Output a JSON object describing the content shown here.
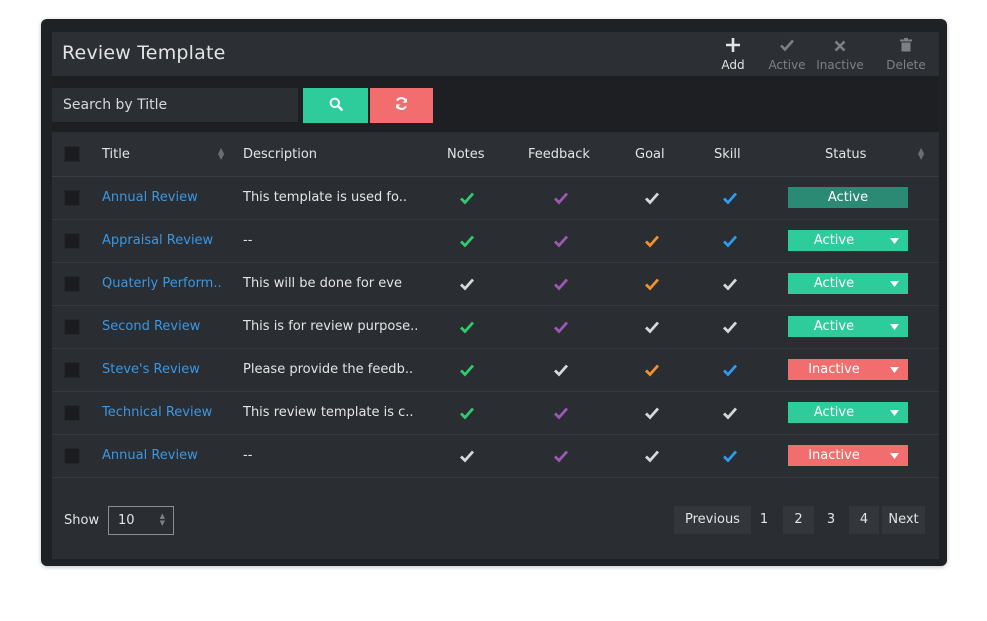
{
  "header": {
    "title": "Review Template",
    "tools": [
      {
        "label": "Add",
        "icon": "plus-icon",
        "enabled": true
      },
      {
        "label": "Active",
        "icon": "check-icon",
        "enabled": false
      },
      {
        "label": "Inactive",
        "icon": "x-icon",
        "enabled": false
      },
      {
        "label": "Delete",
        "icon": "trash-icon",
        "enabled": false
      }
    ]
  },
  "search": {
    "placeholder": "Search by Title",
    "value": ""
  },
  "colors": {
    "accent_green": "#2ecc9b",
    "accent_red": "#f26d6d",
    "link_blue": "#3b97e3",
    "check_green": "#2ecc71",
    "check_purple": "#9b59b6",
    "check_orange": "#f0932b",
    "check_gray": "#d8d9db",
    "check_blue": "#2d9cf0"
  },
  "table": {
    "columns": [
      "Title",
      "Description",
      "Notes",
      "Feedback",
      "Goal",
      "Skill",
      "Status"
    ],
    "rows": [
      {
        "title": "Annual Review",
        "description": "This template is used fo..",
        "notes": "green",
        "feedback": "purple",
        "goal": "gray",
        "skill": "blue",
        "status": "Active",
        "status_style": "dark"
      },
      {
        "title": "Appraisal Review",
        "description": "--",
        "notes": "green",
        "feedback": "purple",
        "goal": "orange",
        "skill": "blue",
        "status": "Active",
        "status_style": "green"
      },
      {
        "title": "Quaterly Perform..",
        "description": "This will be done for eve",
        "notes": "gray",
        "feedback": "purple",
        "goal": "orange",
        "skill": "gray",
        "status": "Active",
        "status_style": "green"
      },
      {
        "title": "Second Review",
        "description": "This is for review purpose..",
        "notes": "green",
        "feedback": "purple",
        "goal": "gray",
        "skill": "gray",
        "status": "Active",
        "status_style": "green"
      },
      {
        "title": "Steve's Review",
        "description": "Please provide the feedb..",
        "notes": "green",
        "feedback": "gray",
        "goal": "orange",
        "skill": "blue",
        "status": "Inactive",
        "status_style": "red"
      },
      {
        "title": "Technical Review",
        "description": "This review template is c..",
        "notes": "green",
        "feedback": "purple",
        "goal": "gray",
        "skill": "gray",
        "status": "Active",
        "status_style": "green"
      },
      {
        "title": "Annual Review",
        "description": "--",
        "notes": "gray",
        "feedback": "purple",
        "goal": "gray",
        "skill": "blue",
        "status": "Inactive",
        "status_style": "red"
      }
    ]
  },
  "footer": {
    "show_label": "Show",
    "page_size": "10",
    "pagination": {
      "previous": "Previous",
      "pages": [
        "1",
        "2",
        "3",
        "4"
      ],
      "current": "2",
      "next": "Next"
    }
  }
}
